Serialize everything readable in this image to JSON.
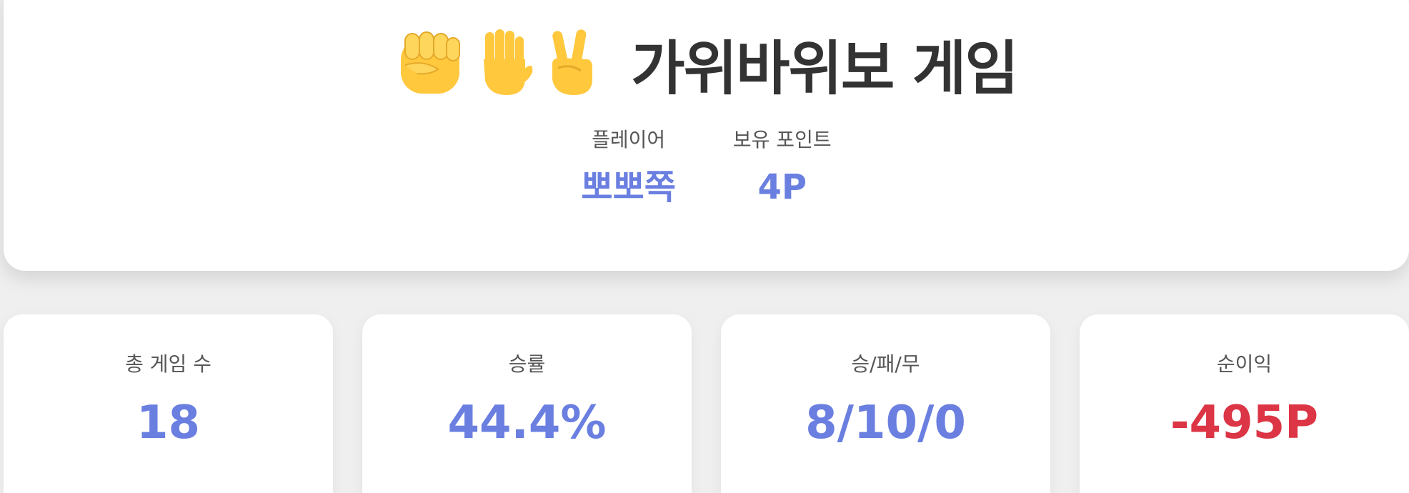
{
  "header": {
    "title": "가위바위보 게임",
    "icons": [
      "raised-fist-icon",
      "raised-hand-icon",
      "victory-hand-icon"
    ],
    "player_label": "플레이어",
    "player_name": "뽀뽀쪽",
    "points_label": "보유 포인트",
    "points_value": "4P"
  },
  "stats": [
    {
      "label": "총 게임 수",
      "value": "18"
    },
    {
      "label": "승률",
      "value": "44.4%"
    },
    {
      "label": "승/패/무",
      "value": "8/10/0"
    },
    {
      "label": "순이익",
      "value": "-495P"
    }
  ],
  "colors": {
    "accent": "#6a7fe0",
    "negative": "#dc3545",
    "title": "#333333",
    "emoji": "#FFC83D"
  }
}
